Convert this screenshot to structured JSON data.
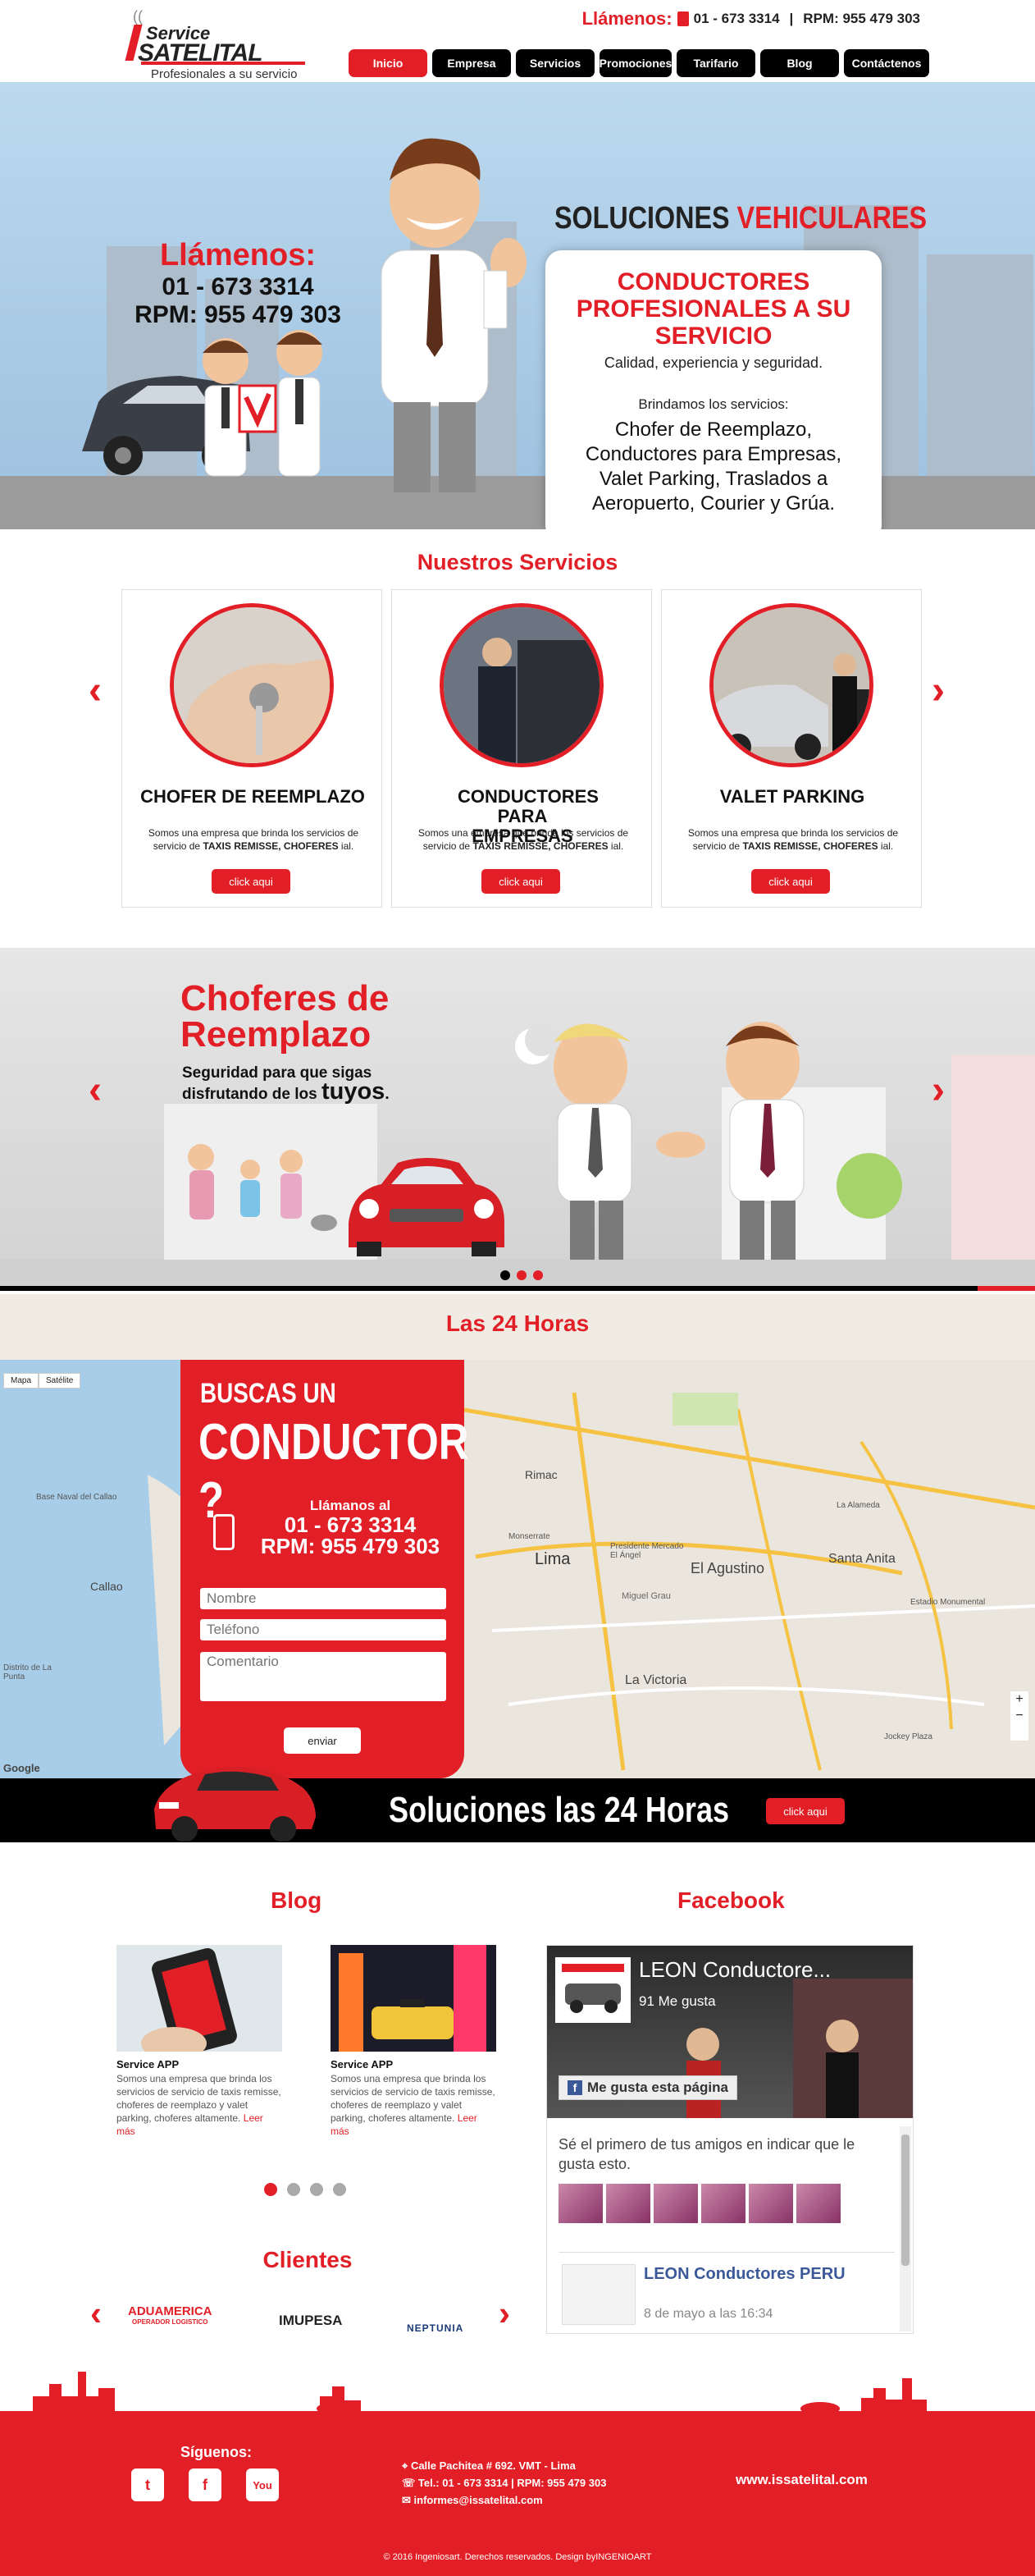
{
  "header": {
    "logo": {
      "line1": "Service",
      "line2": "SATELITAL",
      "tagline": "Profesionales a su servicio"
    },
    "call_label": "Llámenos:",
    "phone": "01 - 673 3314",
    "separator": "|",
    "rpm": "RPM: 955 479 303",
    "nav": [
      "Inicio",
      "Empresa",
      "Servicios",
      "Promociones",
      "Tarifario",
      "Blog",
      "Contáctenos"
    ]
  },
  "hero": {
    "call_label": "Llámenos:",
    "phone": "01 - 673 3314",
    "rpm": "RPM: 955 479 303",
    "headline_part1": "SOLUCIONES",
    "headline_part2": "VEHICULARES",
    "card_title": "CONDUCTORES PROFESIONALES A SU SERVICIO",
    "card_subtitle": "Calidad, experiencia y seguridad.",
    "card_intro": "Brindamos los servicios:",
    "card_list": "Chofer de Reemplazo, Conductores para Empresas, Valet Parking, Traslados a Aeropuerto, Courier y Grúa."
  },
  "services": {
    "title": "Nuestros Servicios",
    "cards": [
      {
        "name": "CHOFER DE REEMPLAZO",
        "desc_pre": "Somos una empresa que brinda los servicios de servicio de ",
        "desc_bold": "TAXIS REMISSE, CHOFERES",
        "desc_post": " ial.",
        "button": "click aqui"
      },
      {
        "name": "CONDUCTORES PARA EMPRESAS",
        "desc_pre": "Somos una empresa que brinda los servicios de servicio de ",
        "desc_bold": "TAXIS REMISSE, CHOFERES",
        "desc_post": " ial.",
        "button": "click aqui"
      },
      {
        "name": "VALET PARKING",
        "desc_pre": "Somos una empresa que brinda los servicios de servicio de ",
        "desc_bold": "TAXIS REMISSE, CHOFERES",
        "desc_post": " ial.",
        "button": "click aqui"
      }
    ],
    "prev_icon": "chevron-left-icon",
    "next_icon": "chevron-right-icon"
  },
  "promo": {
    "title_line1": "Choferes de",
    "title_line2": "Reemplazo",
    "sub_line1": "Seguridad para que sigas",
    "sub_line2": "disfrutando de los",
    "sub_big": "tuyos",
    "sub_end": ".",
    "active_slide": 2,
    "slides": 3
  },
  "hours": {
    "title": "Las 24 Horas",
    "map_buttons": [
      "Mapa",
      "Satélite"
    ],
    "map_brand": "Google",
    "map_labels": [
      "Rimac",
      "Lima",
      "El Agustino",
      "Santa Anita",
      "Miguel Grau",
      "La Victoria",
      "Callao",
      "Base Naval del Callao",
      "Distrito de La Punta",
      "Presidente Mercado El Ángel",
      "Estadio Monumental",
      "Jockey Plaza",
      "Monserrate",
      "La Alameda"
    ]
  },
  "form": {
    "title1": "BUSCAS UN",
    "title2": "CONDUCTOR ?",
    "call_label": "Llámanos al",
    "phone": "01 - 673 3314",
    "rpm": "RPM: 955 479 303",
    "name_placeholder": "Nombre",
    "phone_placeholder": "Teléfono",
    "comment_placeholder": "Comentario",
    "send": "enviar"
  },
  "strip": {
    "text": "Soluciones las 24 Horas",
    "button": "click aqui"
  },
  "blog": {
    "title": "Blog",
    "posts": [
      {
        "title": "Service APP",
        "desc": "Somos una empresa que brinda los servicios de servicio de taxis remisse, choferes de reemplazo y valet parking, choferes altamente.",
        "more": "Leer más"
      },
      {
        "title": "Service APP",
        "desc": "Somos una empresa que brinda los servicios de servicio de taxis remisse, choferes de reemplazo y valet parking, choferes altamente.",
        "more": "Leer más"
      }
    ],
    "active_dot": 0,
    "dots": 4
  },
  "facebook": {
    "title": "Facebook",
    "page_name": "LEON Conductore...",
    "likes": "91 Me gusta",
    "like_button": "Me gusta esta página",
    "friends_text": "Sé el primero de tus amigos en indicar que le gusta esto.",
    "post_name": "LEON Conductores PERU",
    "post_date": "8 de mayo a las 16:34"
  },
  "clients": {
    "title": "Clientes",
    "logos": [
      "ADUAMERICA",
      "IMUPESA",
      "NEPTUNIA"
    ],
    "aduamerica_sub": "OPERADOR LOGISTICO"
  },
  "footer": {
    "follow": "Síguenos:",
    "social": [
      "twitter-icon",
      "facebook-icon",
      "youtube-icon"
    ],
    "address": "Calle Pachitea # 692. VMT - Lima",
    "phones": "Tel.: 01 - 673 3314  |  RPM: 955 479 303",
    "email": "informes@issatelital.com",
    "website": "www.issatelital.com",
    "copyright": "© 2016 Ingeniosart. Derechos reservados. Design byINGENIOART"
  },
  "colors": {
    "brand_red": "#e21e26",
    "nav_black": "#000000",
    "footer": "#e21e26"
  }
}
